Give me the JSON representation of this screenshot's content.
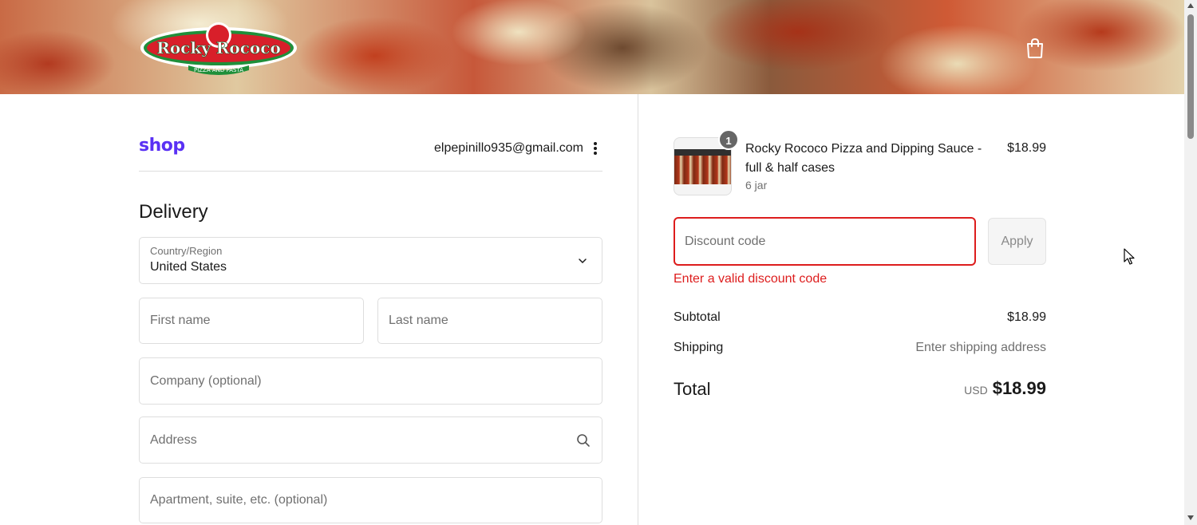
{
  "header": {
    "brand_logo_text": "Rocky Rococo",
    "brand_logo_subtext": "PIZZA AND PASTA",
    "cart_icon": "shopping-bag-icon"
  },
  "account": {
    "shop_logo": "shop",
    "email": "elpepinillo935@gmail.com",
    "menu_icon": "vertical-ellipsis-icon"
  },
  "delivery": {
    "title": "Delivery",
    "country_label": "Country/Region",
    "country_value": "United States",
    "first_name_placeholder": "First name",
    "last_name_placeholder": "Last name",
    "company_placeholder": "Company (optional)",
    "address_placeholder": "Address",
    "apartment_placeholder": "Apartment, suite, etc. (optional)"
  },
  "order": {
    "item": {
      "quantity": "1",
      "name": "Rocky Rococo Pizza and Dipping Sauce - full & half cases",
      "variant": "6 jar",
      "price": "$18.99"
    },
    "discount": {
      "placeholder": "Discount code",
      "apply_label": "Apply",
      "error": "Enter a valid discount code"
    },
    "subtotal_label": "Subtotal",
    "subtotal_value": "$18.99",
    "shipping_label": "Shipping",
    "shipping_value": "Enter shipping address",
    "total_label": "Total",
    "total_currency": "USD",
    "total_value": "$18.99"
  },
  "colors": {
    "shop_brand": "#5a31f4",
    "error": "#dd1d1d",
    "border": "#dedede"
  }
}
